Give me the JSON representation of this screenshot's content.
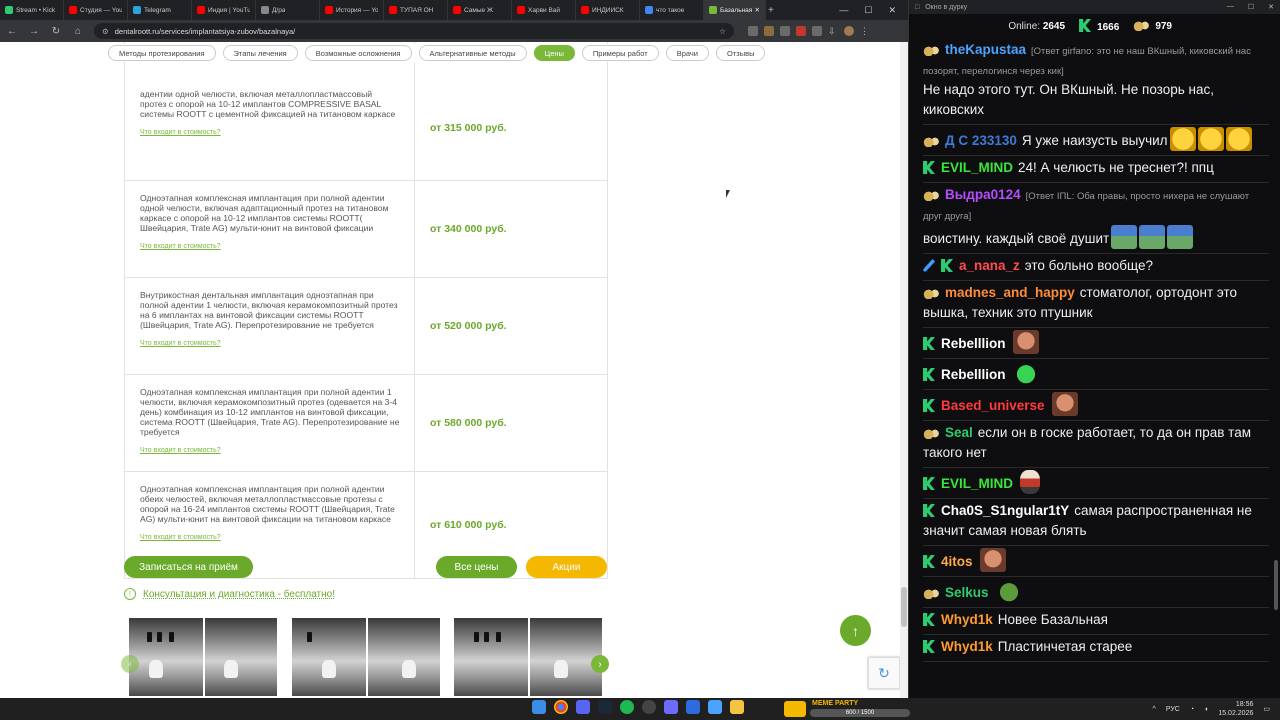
{
  "browser": {
    "tabs": [
      {
        "label": "Stream • Kick",
        "color": "#2ecc71"
      },
      {
        "label": "Студия — YouTube",
        "color": "#ff0000"
      },
      {
        "label": "Telegram",
        "color": "#2aa3df"
      },
      {
        "label": "Индия | YouTube",
        "color": "#ff0000"
      },
      {
        "label": "Д/ра",
        "color": "#888888"
      },
      {
        "label": "История — YouTube",
        "color": "#ff0000"
      },
      {
        "label": "ТУПАЯ ОН",
        "color": "#ff0000"
      },
      {
        "label": "Самые Ж",
        "color": "#ff0000"
      },
      {
        "label": "Харви Вай",
        "color": "#ff0000"
      },
      {
        "label": "ИНДИЙСК",
        "color": "#ff0000"
      },
      {
        "label": "что такое",
        "color": "#4285f4"
      },
      {
        "label": "Базальная",
        "color": "#7ab83a",
        "active": true
      }
    ],
    "new_tab": "+",
    "url": "dentalroott.ru/services/implantatsiya-zubov/bazalnaya/",
    "ext_badges": [
      "192",
      "12"
    ]
  },
  "site": {
    "nav": [
      "Методы протезирования",
      "Этапы лечения",
      "Возможные осложнения",
      "Альтернативные методы",
      "Цены",
      "Примеры работ",
      "Врачи",
      "Отзывы"
    ],
    "nav_active": "Цены",
    "rows": [
      {
        "desc": "адентии одной челюсти, включая металлопластмассовый протез с опорой на 10-12 имплантов COMPRESSIVE BASAL системы ROOTT с цементной фиксацией на титановом каркасе",
        "price": "от 315 000 руб."
      },
      {
        "desc": "Одноэтапная комплексная имплантация при полной адентии одной челюсти, включая адаптационный протез на титановом каркасе с опорой на 10-12 имплантов системы ROOTT( Швейцария, Trate AG) мульти-юнит на винтовой фиксации",
        "price": "от 340 000 руб."
      },
      {
        "desc": "Внутрикостная дентальная имплантация одноэтапная при полной адентии 1 челюсти, включая керамокомпозитный протез на 6 имплантах на винтовой фиксации системы ROOTT (Швейцария, Trate AG). Перепротезирование не требуется",
        "price": "от 520 000 руб."
      },
      {
        "desc": "Одноэтапная комплексная имплантация при полной адентии 1 челюсти, включая керамокомпозитный протез (одевается на 3-4 день) комбинация из 10-12 имплантов на винтовой фиксации, система ROOTT (Швейцария, Trate AG). Перепротезирование не требуется",
        "price": "от 580 000 руб."
      },
      {
        "desc": "Одноэтапная комплексная имплантация при полной адентии обеих челюстей, включая металлопластмассовые протезы с опорой на 16-24 имплантов системы ROOTT (Швейцария, Trate AG) мульти-юнит на винтовой фиксации на титановом каркасе",
        "price": "от 610 000 руб."
      }
    ],
    "more_label": "Что входит в стоимость?",
    "btn_book": "Записаться на приём",
    "btn_all_prices": "Все цены",
    "btn_promo": "Акции",
    "consult_text": "Консультация и диагностика - бесплатно!"
  },
  "chat": {
    "window_title": "Окно в дурку",
    "online_label": "Online:",
    "online_count": "2645",
    "kick_count": "1666",
    "bird_count": "979",
    "messages": [
      {
        "badges": [
          "bird"
        ],
        "nick": "theKapustaa",
        "color": "#4aa3ff",
        "reply": "[Ответ girfano: это не наш ВКшный, киковский нас позорят, перелогинся через кик]",
        "text": "Не надо этого тут. Он ВКшный. Не позорь нас, киковских",
        "emotes": []
      },
      {
        "badges": [
          "bird"
        ],
        "nick": "Д С 233130",
        "color": "#3a7bd5",
        "reply": "",
        "text": "Я уже наизусть выучил",
        "emotes": [
          "e-lol",
          "e-lol",
          "e-lol"
        ]
      },
      {
        "badges": [
          "kick"
        ],
        "nick": "EVIL_MIND",
        "color": "#39e639",
        "reply": "",
        "text": "24! А челюсть не треснет?! ппц",
        "emotes": []
      },
      {
        "badges": [
          "bird"
        ],
        "nick": "Выдра0124",
        "color": "#b44cff",
        "reply": "[Ответ IПL: Оба правы, просто нихера не слушают друг друга]",
        "text": "воистину. каждый своё душит",
        "emotes": [
          "e-land",
          "e-land",
          "e-land"
        ]
      },
      {
        "badges": [
          "mod",
          "kick"
        ],
        "nick": "a_nana_z",
        "color": "#ff4d4d",
        "reply": "",
        "text": "это больно вообще?",
        "emotes": []
      },
      {
        "badges": [
          "bird"
        ],
        "nick": "madnes_and_happy",
        "color": "#ff8c3a",
        "reply": "",
        "text": "стоматолог, ортодонт это вышка, техник это птушник",
        "emotes": []
      },
      {
        "badges": [
          "kick"
        ],
        "nick": "Rebelllion",
        "color": "#ffffff",
        "reply": "",
        "text": "",
        "emotes": [
          "e-face"
        ]
      },
      {
        "badges": [
          "kick"
        ],
        "nick": "Rebelllion",
        "color": "#ffffff",
        "reply": "",
        "text": "",
        "emotes": [
          "e-blob"
        ]
      },
      {
        "badges": [
          "kick"
        ],
        "nick": "Based_universe",
        "color": "#ff3b3b",
        "reply": "",
        "text": "",
        "emotes": [
          "e-face"
        ]
      },
      {
        "badges": [
          "bird"
        ],
        "nick": "Seal",
        "color": "#2ecc71",
        "reply": "",
        "text": "если он в госке работает, то да он прав там такого нет",
        "emotes": []
      },
      {
        "badges": [
          "kick"
        ],
        "nick": "EVIL_MIND",
        "color": "#39e639",
        "reply": "",
        "text": "",
        "emotes": [
          "e-sit"
        ]
      },
      {
        "badges": [
          "kick"
        ],
        "nick": "Cha0S_S1ngular1tY",
        "color": "#ffffff",
        "reply": "",
        "text": "самая распространенная не значит самая новая блять",
        "emotes": []
      },
      {
        "badges": [
          "kick"
        ],
        "nick": "4itos",
        "color": "#ffa94d",
        "reply": "",
        "text": "",
        "emotes": [
          "e-face"
        ]
      },
      {
        "badges": [
          "bird"
        ],
        "nick": "Selkus",
        "color": "#2ecc71",
        "reply": "",
        "text": "",
        "emotes": [
          "e-pepe"
        ]
      },
      {
        "badges": [
          "kick"
        ],
        "nick": "Whyd1k",
        "color": "#ff9a2e",
        "reply": "",
        "text": "Новее Базальная",
        "emotes": []
      },
      {
        "badges": [
          "kick"
        ],
        "nick": "Whyd1k",
        "color": "#ff9a2e",
        "reply": "",
        "text": "Пластинчетая старее",
        "emotes": []
      }
    ]
  },
  "taskbar": {
    "widget_title": "MEME PARTY",
    "widget_progress_text": "600 / 1500",
    "widget_progress": 0.4,
    "lang": "РУС",
    "time": "18:56",
    "date": "15.02.2026"
  }
}
